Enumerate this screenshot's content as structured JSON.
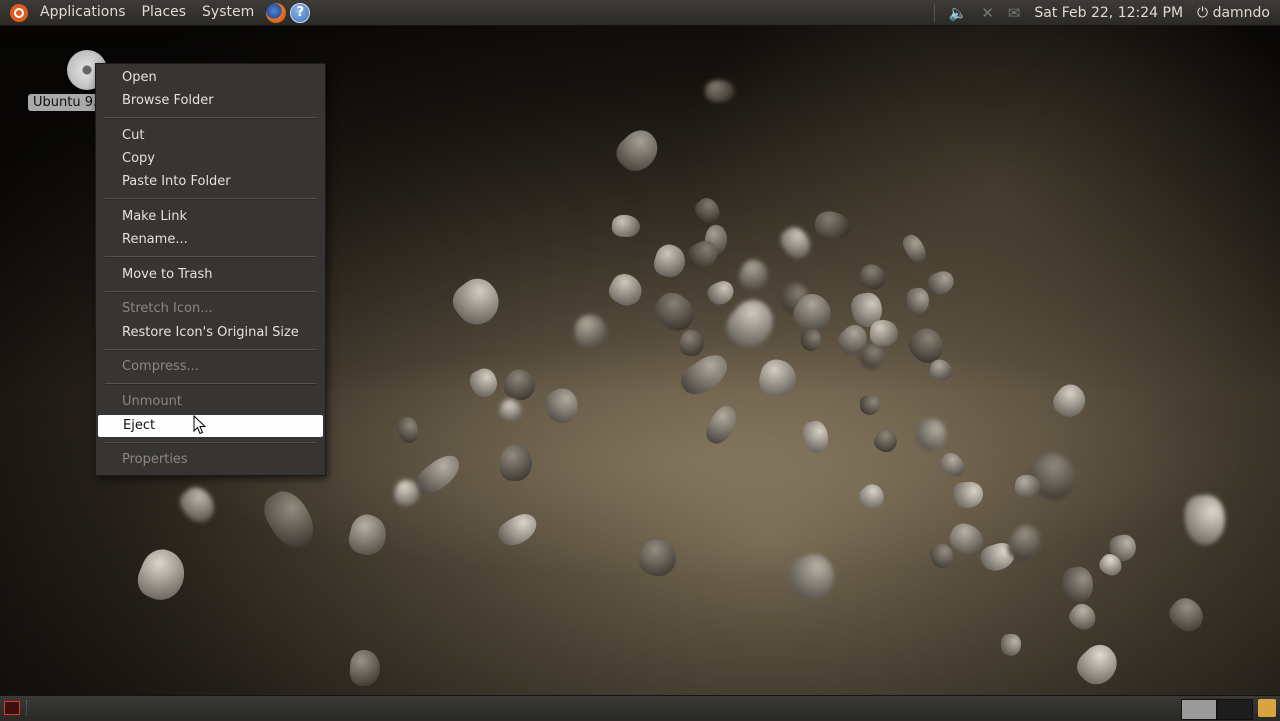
{
  "top_panel": {
    "menus": [
      "Applications",
      "Places",
      "System"
    ],
    "datetime": "Sat Feb 22, 12:24 PM",
    "user": "damndo",
    "icons": [
      "ubuntu-logo-icon",
      "firefox-icon",
      "help-icon",
      "volume-icon",
      "network-icon",
      "mail-icon",
      "power-icon"
    ]
  },
  "desktop": {
    "icon_label": "Ubuntu 9."
  },
  "context_menu": {
    "items": [
      {
        "label": "Open",
        "enabled": true
      },
      {
        "label": "Browse Folder",
        "enabled": true
      },
      {
        "label": "Cut",
        "enabled": true
      },
      {
        "label": "Copy",
        "enabled": true
      },
      {
        "label": "Paste Into Folder",
        "enabled": true
      },
      {
        "label": "Make Link",
        "enabled": true
      },
      {
        "label": "Rename...",
        "enabled": true
      },
      {
        "label": "Move to Trash",
        "enabled": true
      },
      {
        "label": "Stretch Icon...",
        "enabled": false
      },
      {
        "label": "Restore Icon's Original Size",
        "enabled": true
      },
      {
        "label": "Compress...",
        "enabled": false
      },
      {
        "label": "Unmount",
        "enabled": false
      },
      {
        "label": "Eject",
        "enabled": true,
        "highlighted": true
      },
      {
        "label": "Properties",
        "enabled": false
      }
    ]
  },
  "bottom_panel": {
    "workspaces": 2,
    "icons": [
      "show-desktop-icon",
      "trash-icon"
    ]
  }
}
